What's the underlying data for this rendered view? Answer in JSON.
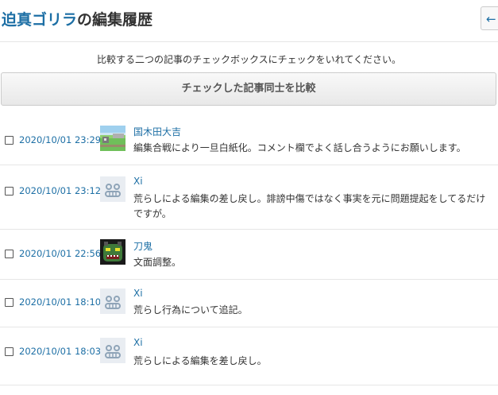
{
  "header": {
    "article_name": "迫真ゴリラ",
    "title_suffix": "の編集履歴",
    "back_arrow": "←"
  },
  "instruction": "比較する二つの記事のチェックボックスにチェックをいれてください。",
  "compare_button_label": "チェックした記事同士を比較",
  "history": [
    {
      "date": "2020/10/01 23:29",
      "user": "国木田大吉",
      "avatar": "landscape-avatar",
      "summary": "編集合戦により一旦白紙化。コメント欄でよく話し合うようにお願いします。"
    },
    {
      "date": "2020/10/01 23:12",
      "user": "Xi",
      "avatar": "default-face-avatar",
      "summary": "荒らしによる編集の差し戻し。誹謗中傷ではなく事実を元に問題提起をしてるだけですが。"
    },
    {
      "date": "2020/10/01 22:56",
      "user": "刀鬼",
      "avatar": "green-monster-avatar",
      "summary": "文面調整。"
    },
    {
      "date": "2020/10/01 18:10",
      "user": "Xi",
      "avatar": "default-face-avatar",
      "summary": "荒らし行為について追記。"
    },
    {
      "date": "2020/10/01 18:03",
      "user": "Xi",
      "avatar": "default-face-avatar",
      "summary": "荒らしによる編集を差し戻し。"
    }
  ]
}
